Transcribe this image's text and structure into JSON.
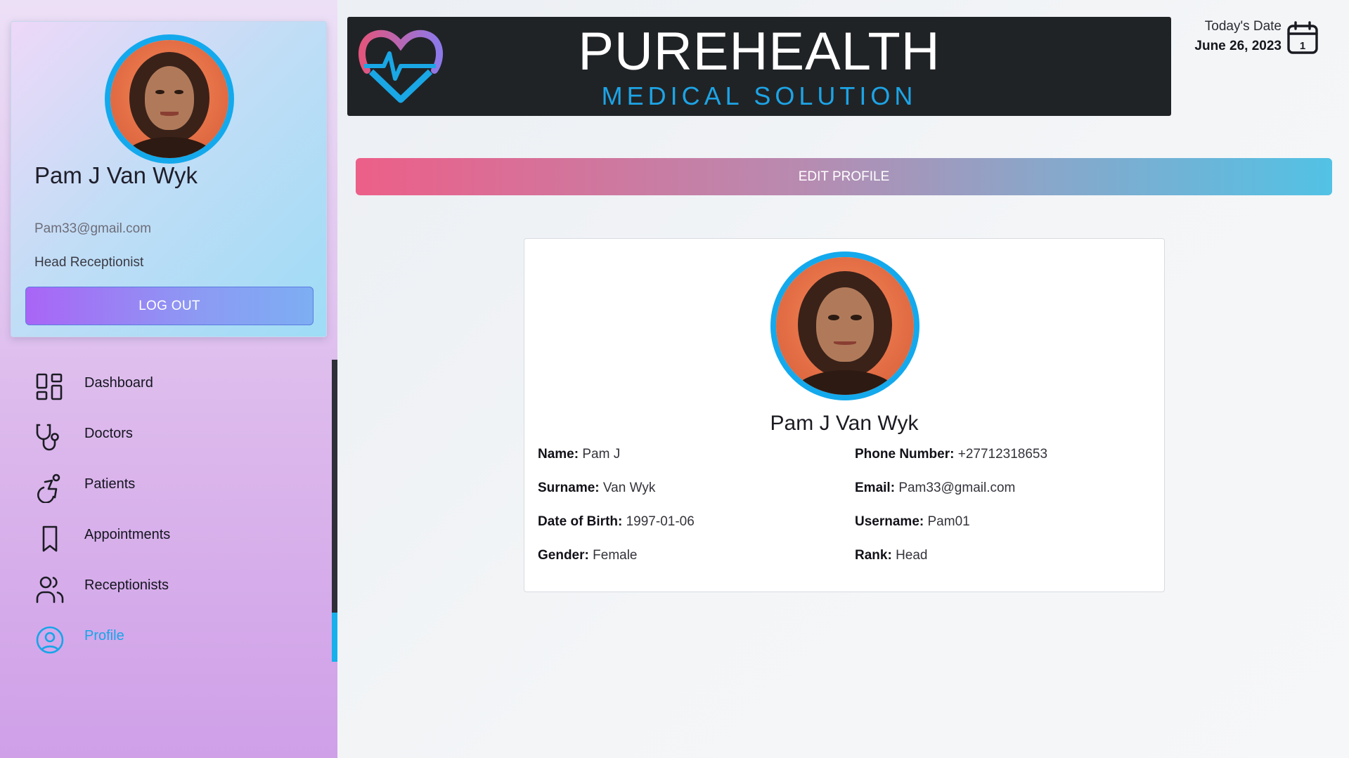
{
  "sidebar": {
    "user": {
      "name": "Pam J Van Wyk",
      "email": "Pam33@gmail.com",
      "role": "Head Receptionist"
    },
    "logout_label": "LOG OUT",
    "nav": [
      {
        "label": "Dashboard",
        "icon": "dashboard-grid-icon",
        "active": false
      },
      {
        "label": "Doctors",
        "icon": "stethoscope-icon",
        "active": false
      },
      {
        "label": "Patients",
        "icon": "wheelchair-icon",
        "active": false
      },
      {
        "label": "Appointments",
        "icon": "bookmark-icon",
        "active": false
      },
      {
        "label": "Receptionists",
        "icon": "users-icon",
        "active": false
      },
      {
        "label": "Profile",
        "icon": "user-circle-icon",
        "active": true
      }
    ]
  },
  "header": {
    "brand_title": "PUREHEALTH",
    "brand_subtitle": "MEDICAL  SOLUTION",
    "date_label": "Today's Date",
    "date_value": "June 26, 2023",
    "calendar_day": "1"
  },
  "main": {
    "edit_profile_label": "EDIT PROFILE",
    "profile": {
      "full_name": "Pam J Van Wyk",
      "fields": [
        {
          "key": "Name:",
          "value": "Pam J"
        },
        {
          "key": "Surname:",
          "value": "Van Wyk"
        },
        {
          "key": "Date of Birth:",
          "value": "1997-01-06"
        },
        {
          "key": "Gender:",
          "value": "Female"
        },
        {
          "key": "Phone Number:",
          "value": "+27712318653"
        },
        {
          "key": "Email:",
          "value": "Pam33@gmail.com"
        },
        {
          "key": "Username:",
          "value": "Pam01"
        },
        {
          "key": "Rank:",
          "value": "Head"
        }
      ]
    }
  },
  "colors": {
    "accent_blue": "#14a9ec",
    "banner_dark": "#202326",
    "edit_gradient_start": "#ec5f88",
    "edit_gradient_end": "#52c2e5"
  }
}
